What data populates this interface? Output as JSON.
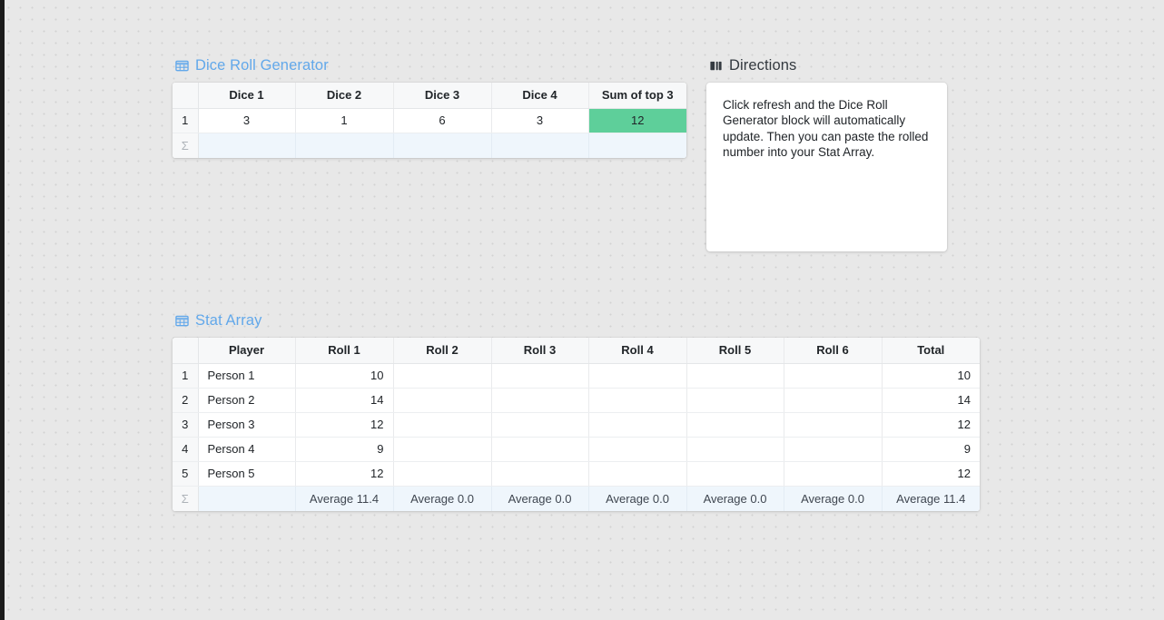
{
  "theme": {
    "accent_title_color": "#62a8ea",
    "highlight_green": "#5ecf9a",
    "summary_row_color": "#eff6fc",
    "canvas_color": "#e8e8e8"
  },
  "dice_block": {
    "title": "Dice Roll Generator",
    "icon": "table-icon",
    "columns": [
      "Dice 1",
      "Dice 2",
      "Dice 3",
      "Dice 4",
      "Sum of top 3"
    ],
    "rows": [
      {
        "number": "1",
        "cells": [
          "3",
          "1",
          "6",
          "3",
          "12"
        ]
      }
    ],
    "summary": {
      "number": "Σ",
      "cells": [
        "",
        "",
        "",
        "",
        ""
      ]
    }
  },
  "directions_block": {
    "title": "Directions",
    "icon": "book-icon",
    "body": "Click refresh and the Dice Roll Generator block will automatically update. Then you can paste the rolled number into your Stat Array."
  },
  "stat_block": {
    "title": "Stat Array",
    "icon": "table-icon",
    "columns": [
      "Player",
      "Roll 1",
      "Roll 2",
      "Roll 3",
      "Roll 4",
      "Roll 5",
      "Roll 6",
      "Total"
    ],
    "rows": [
      {
        "number": "1",
        "cells": [
          "Person 1",
          "10",
          "",
          "",
          "",
          "",
          "",
          "10"
        ]
      },
      {
        "number": "2",
        "cells": [
          "Person 2",
          "14",
          "",
          "",
          "",
          "",
          "",
          "14"
        ]
      },
      {
        "number": "3",
        "cells": [
          "Person 3",
          "12",
          "",
          "",
          "",
          "",
          "",
          "12"
        ]
      },
      {
        "number": "4",
        "cells": [
          "Person 4",
          "9",
          "",
          "",
          "",
          "",
          "",
          "9"
        ]
      },
      {
        "number": "5",
        "cells": [
          "Person 5",
          "12",
          "",
          "",
          "",
          "",
          "",
          "12"
        ]
      }
    ],
    "summary": {
      "number": "Σ",
      "cells": [
        "",
        "Average 11.4",
        "Average 0.0",
        "Average 0.0",
        "Average 0.0",
        "Average 0.0",
        "Average 0.0",
        "Average 11.4"
      ]
    }
  }
}
